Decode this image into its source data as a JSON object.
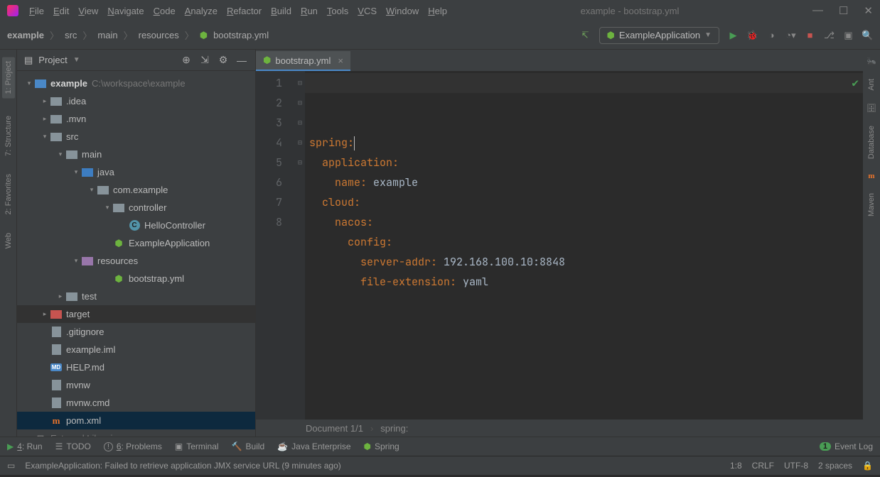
{
  "window": {
    "title": "example - bootstrap.yml"
  },
  "menu": [
    "File",
    "Edit",
    "View",
    "Navigate",
    "Code",
    "Analyze",
    "Refactor",
    "Build",
    "Run",
    "Tools",
    "VCS",
    "Window",
    "Help"
  ],
  "breadcrumbs": [
    "example",
    "src",
    "main",
    "resources",
    "bootstrap.yml"
  ],
  "run_config": "ExampleApplication",
  "project_panel": {
    "title": "Project"
  },
  "tree": [
    {
      "d": 0,
      "a": "v",
      "i": "mod",
      "t": "example",
      "path": "C:\\workspace\\example"
    },
    {
      "d": 1,
      "a": ">",
      "i": "dir",
      "t": ".idea"
    },
    {
      "d": 1,
      "a": ">",
      "i": "dir",
      "t": ".mvn"
    },
    {
      "d": 1,
      "a": "v",
      "i": "dir",
      "t": "src"
    },
    {
      "d": 2,
      "a": "v",
      "i": "dir",
      "t": "main"
    },
    {
      "d": 3,
      "a": "v",
      "i": "srcdir",
      "t": "java"
    },
    {
      "d": 4,
      "a": "v",
      "i": "pkg",
      "t": "com.example"
    },
    {
      "d": 5,
      "a": "v",
      "i": "pkg",
      "t": "controller"
    },
    {
      "d": 6,
      "a": "",
      "i": "class",
      "t": "HelloController"
    },
    {
      "d": 5,
      "a": "",
      "i": "spring",
      "t": "ExampleApplication"
    },
    {
      "d": 3,
      "a": "v",
      "i": "res",
      "t": "resources"
    },
    {
      "d": 5,
      "a": "",
      "i": "spring",
      "t": "bootstrap.yml"
    },
    {
      "d": 2,
      "a": ">",
      "i": "dir",
      "t": "test"
    },
    {
      "d": 1,
      "a": ">",
      "i": "excl",
      "t": "target",
      "cls": "hov"
    },
    {
      "d": 1,
      "a": "",
      "i": "file",
      "t": ".gitignore"
    },
    {
      "d": 1,
      "a": "",
      "i": "file",
      "t": "example.iml"
    },
    {
      "d": 1,
      "a": "",
      "i": "md",
      "t": "HELP.md"
    },
    {
      "d": 1,
      "a": "",
      "i": "file",
      "t": "mvnw"
    },
    {
      "d": 1,
      "a": "",
      "i": "file",
      "t": "mvnw.cmd"
    },
    {
      "d": 1,
      "a": "",
      "i": "pom",
      "t": "pom.xml",
      "cls": "sel"
    },
    {
      "d": 0,
      "a": ">",
      "i": "lib",
      "t": "External Libraries",
      "dim": true
    }
  ],
  "tab": {
    "name": "bootstrap.yml"
  },
  "code": [
    {
      "n": 1,
      "l": "spring:",
      "cursor": true
    },
    {
      "n": 2,
      "l": "  application:"
    },
    {
      "n": 3,
      "l": "    name: example"
    },
    {
      "n": 4,
      "l": "  cloud:"
    },
    {
      "n": 5,
      "l": "    nacos:"
    },
    {
      "n": 6,
      "l": "      config:"
    },
    {
      "n": 7,
      "l": "        server-addr: 192.168.100.10:8848"
    },
    {
      "n": 8,
      "l": "        file-extension: yaml"
    }
  ],
  "code_crumb": {
    "doc": "Document 1/1",
    "path": "spring:"
  },
  "left_tools": [
    {
      "t": "1: Project",
      "active": true
    },
    {
      "t": "7: Structure"
    },
    {
      "t": "2: Favorites"
    },
    {
      "t": "Web"
    }
  ],
  "right_tools": [
    "Ant",
    "Database",
    "Maven"
  ],
  "bottom_tools": [
    {
      "i": "run",
      "t": "4: Run"
    },
    {
      "i": "todo",
      "t": "TODO"
    },
    {
      "i": "prob",
      "t": "6: Problems"
    },
    {
      "i": "term",
      "t": "Terminal"
    },
    {
      "i": "build",
      "t": "Build"
    },
    {
      "i": "jee",
      "t": "Java Enterprise"
    },
    {
      "i": "spring",
      "t": "Spring"
    }
  ],
  "event_log": "Event Log",
  "status": {
    "msg": "ExampleApplication: Failed to retrieve application JMX service URL (9 minutes ago)",
    "pos": "1:8",
    "eol": "CRLF",
    "enc": "UTF-8",
    "indent": "2 spaces"
  }
}
